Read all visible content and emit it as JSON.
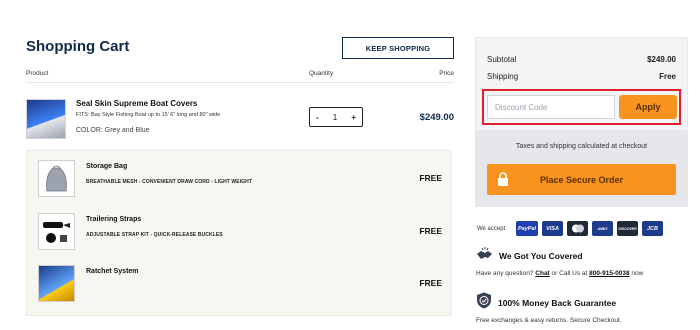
{
  "cart": {
    "title": "Shopping Cart",
    "keep_shopping": "KEEP SHOPPING",
    "columns": {
      "product": "Product",
      "quantity": "Quantity",
      "price": "Price"
    },
    "main_item": {
      "name": "Seal Skin Supreme Boat Covers",
      "fits": "FITS: Bay Style Fishing Boat up to 15' 6\" long and 80\" wide",
      "color": "COLOR: Grey and Blue",
      "qty_minus": "-",
      "quantity": "1",
      "qty_plus": "+",
      "price": "$249.00"
    },
    "addons": [
      {
        "name": "Storage Bag",
        "desc": "BREATHABLE MESH  -  CONVENIENT DRAW CORD  -  LIGHT WEIGHT",
        "price": "FREE"
      },
      {
        "name": "Trailering Straps",
        "desc": "ADJUSTABLE STRAP KIT  -  QUICK-RELEASE BUCKLES",
        "price": "FREE"
      },
      {
        "name": "Ratchet System",
        "desc": "",
        "price": "FREE"
      }
    ]
  },
  "summary": {
    "subtotal_label": "Subtotal",
    "subtotal_value": "$249.00",
    "shipping_label": "Shipping",
    "shipping_value": "Free",
    "discount_placeholder": "Discount Code",
    "apply": "Apply",
    "tax_note": "Taxes and shipping calculated at checkout",
    "order_button": "Place Secure Order"
  },
  "trust": {
    "we_accept": "We accept",
    "cards": [
      "PayPal",
      "VISA",
      "MC",
      "AMEX",
      "DISCOVER",
      "JCB"
    ],
    "covered_title": "We Got You Covered",
    "covered_pre": "Have any question?",
    "covered_chat": "Chat",
    "covered_mid": "or Call Us at",
    "covered_phone": "800-915-0038",
    "covered_post": "now",
    "money_title": "100% Money Back Guarantee",
    "money_text": "Free exchanges & easy returns. Secure Checkout."
  },
  "colors": {
    "accent": "#f7931e",
    "navy": "#0f2a4a",
    "highlight": "#e11d2e"
  }
}
